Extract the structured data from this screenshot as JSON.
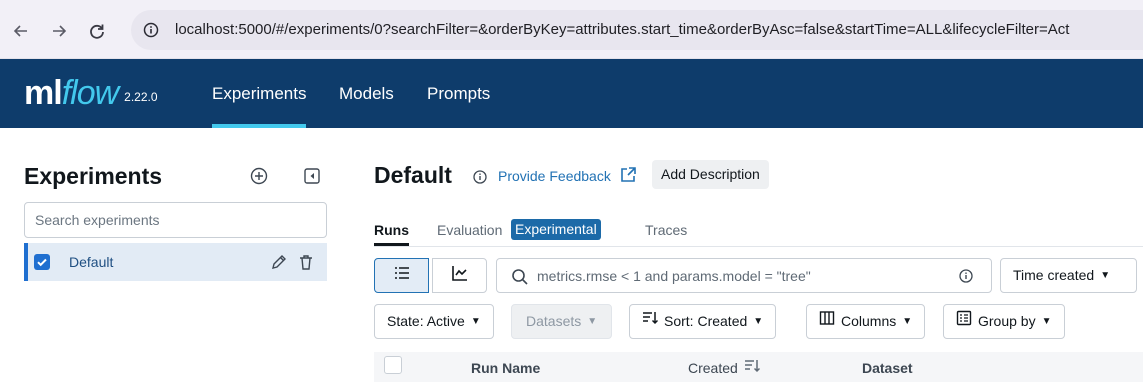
{
  "browser": {
    "url": "localhost:5000/#/experiments/0?searchFilter=&orderByKey=attributes.start_time&orderByAsc=false&startTime=ALL&lifecycleFilter=Act"
  },
  "header": {
    "logo_ml": "ml",
    "logo_flow": "flow",
    "version": "2.22.0",
    "nav": [
      {
        "label": "Experiments"
      },
      {
        "label": "Models"
      },
      {
        "label": "Prompts"
      }
    ]
  },
  "sidebar": {
    "title": "Experiments",
    "search_placeholder": "Search experiments",
    "items": [
      {
        "label": "Default"
      }
    ]
  },
  "main": {
    "title": "Default",
    "feedback_link": "Provide Feedback",
    "add_description": "Add Description",
    "tabs": [
      {
        "label": "Runs"
      },
      {
        "label": "Evaluation"
      },
      {
        "label": "Traces"
      }
    ],
    "evaluation_badge": "Experimental",
    "filter_placeholder": "metrics.rmse < 1 and params.model = \"tree\"",
    "time_created": "Time created",
    "state_filter": "State: Active",
    "datasets": "Datasets",
    "sort": "Sort: Created",
    "columns": "Columns",
    "group_by": "Group by",
    "table_headers": {
      "run_name": "Run Name",
      "created": "Created",
      "dataset": "Dataset"
    }
  },
  "colors": {
    "brand_navy": "#0e3c6b",
    "accent_cyan": "#43c9ed",
    "link_blue": "#2272b4",
    "badge_blue": "#1c6aa8"
  }
}
